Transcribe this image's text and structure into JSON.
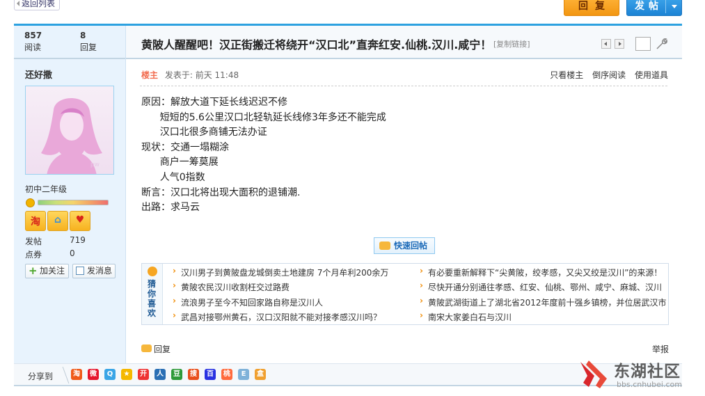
{
  "toolbar": {
    "back_label": "返回列表",
    "reply_label": "回复",
    "post_label": "发帖"
  },
  "stats": {
    "views_value": "857",
    "views_label": "阅读",
    "replies_value": "8",
    "replies_label": "回复"
  },
  "thread": {
    "title": "黄陂人醒醒吧！汉正街搬迁将绕开“汉口北”直奔红安.仙桃.汉川.咸宁！",
    "copy_link_label": "[复制链接]"
  },
  "author": {
    "username": "还好撒",
    "avatar_watermark": "pw",
    "grade": "初中二年级",
    "badges": [
      {
        "icon": "taobao-badge-icon",
        "glyph": "淘"
      },
      {
        "icon": "house-badge-icon",
        "glyph": "⌂"
      },
      {
        "icon": "heart-badge-icon",
        "glyph": "♥"
      }
    ],
    "posts_label": "发帖",
    "posts_value": "719",
    "points_label": "点券",
    "points_value": "0",
    "follow_label": "加关注",
    "message_label": "发消息"
  },
  "post": {
    "author_tag": "楼主",
    "posted_at": "发表于: 前天 11:48",
    "tools": [
      "只看楼主",
      "倒序阅读",
      "使用道具"
    ],
    "lines": [
      "原因：解放大道下延长线迟迟不修",
      "      短短的5.6公里汉口北轻轨延长线修3年多还不能完成",
      "      汉口北很多商铺无法办证",
      "现状：交通一塌糊涂",
      "      商户一筹莫展",
      "      人气0指数",
      "断言：汉口北将出现大面积的退铺潮.",
      "出路：求马云"
    ],
    "quick_reply_label": "快速回帖"
  },
  "recommendations": {
    "label": "猜你喜欢",
    "left": [
      "汉川男子到黄陂盘龙城倒卖土地建房 7个月牟利200余万",
      "黄陂农民汉川收割枉交过路费",
      "流浪男子至今不知回家路自称是汉川人",
      "武昌对接鄂州黄石，汉口汉阳就不能对接孝感汉川吗？"
    ],
    "right": [
      "有必要重新解释下“尖黄陂，绞孝感，又尖又绞是汉川”的来源！",
      "尽快开通分别通往孝感、红安、仙桃、鄂州、咸宁、麻城、汉川",
      "黄陂武湖街道上了湖北省2012年度前十强乡镇榜，并位居武汉市",
      "南宋大家姜白石与汉川"
    ]
  },
  "footer": {
    "reply_label": "回复",
    "report_label": "举报",
    "share_label": "分享到"
  },
  "share_icons": [
    {
      "name": "taobao-share-icon",
      "glyph": "淘",
      "color": "#f05a1a"
    },
    {
      "name": "weibo-share-icon",
      "glyph": "微",
      "color": "#e6162d"
    },
    {
      "name": "qzone-share-icon",
      "glyph": "Q",
      "color": "#3aa5e6"
    },
    {
      "name": "star-share-icon",
      "glyph": "★",
      "color": "#f5b800"
    },
    {
      "name": "kaixin-share-icon",
      "glyph": "开",
      "color": "#e33"
    },
    {
      "name": "renren-share-icon",
      "glyph": "人",
      "color": "#2a6fb4"
    },
    {
      "name": "douban-share-icon",
      "glyph": "豆",
      "color": "#2f9a3a"
    },
    {
      "name": "sohu-share-icon",
      "glyph": "搜",
      "color": "#e94e1b"
    },
    {
      "name": "baidu-share-icon",
      "glyph": "百",
      "color": "#2932e1"
    },
    {
      "name": "fruit-share-icon",
      "glyph": "桃",
      "color": "#ff6a3d"
    },
    {
      "name": "note-share-icon",
      "glyph": "E",
      "color": "#7fb2d9"
    },
    {
      "name": "box-share-icon",
      "glyph": "盒",
      "color": "#f0a030"
    }
  ],
  "watermark": {
    "brand": "东湖社区",
    "url": "bbs.cnhubei.com"
  }
}
